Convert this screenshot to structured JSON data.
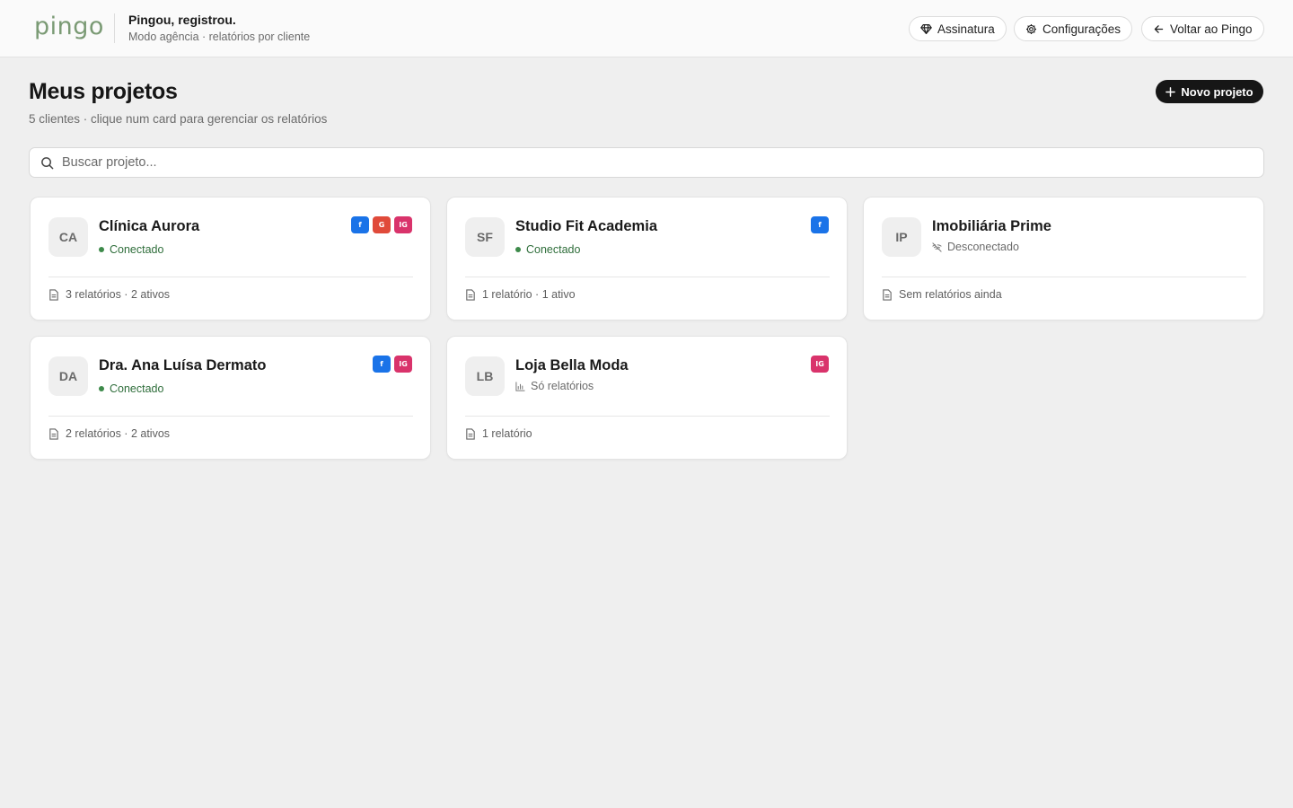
{
  "header": {
    "logo": "pingo",
    "title": "Pingou, registrou.",
    "subtitle": "Modo agência · relatórios por cliente",
    "buttons": {
      "subscription": "Assinatura",
      "settings": "Configurações",
      "back": "Voltar ao Pingo"
    }
  },
  "page": {
    "title": "Meus projetos",
    "subtitle": "5 clientes · clique num card para gerenciar os relatórios",
    "new_button": "Novo projeto"
  },
  "search": {
    "placeholder": "Buscar projeto..."
  },
  "projects": [
    {
      "initials": "CA",
      "name": "Clínica Aurora",
      "status": "Conectado",
      "status_type": "connected",
      "badges": [
        "f",
        "G",
        "IG"
      ],
      "footer": "3 relatórios · 2 ativos"
    },
    {
      "initials": "SF",
      "name": "Studio Fit Academia",
      "status": "Conectado",
      "status_type": "connected",
      "badges": [
        "f"
      ],
      "footer": "1 relatório · 1 ativo"
    },
    {
      "initials": "IP",
      "name": "Imobiliária Prime",
      "status": "Desconectado",
      "status_type": "disconnected",
      "badges": [],
      "footer": "Sem relatórios ainda"
    },
    {
      "initials": "DA",
      "name": "Dra. Ana Luísa Dermato",
      "status": "Conectado",
      "status_type": "connected",
      "badges": [
        "f",
        "IG"
      ],
      "footer": "2 relatórios · 2 ativos"
    },
    {
      "initials": "LB",
      "name": "Loja Bella Moda",
      "status": "Só relatórios",
      "status_type": "reports",
      "badges": [
        "IG"
      ],
      "footer": "1 relatório"
    }
  ],
  "colors": {
    "logo": "#7a9a74",
    "connected": "#2f6e3b",
    "facebook": "#1a73e8",
    "google": "#e04a3a",
    "instagram": "#d9336b",
    "primary_button": "#161616"
  },
  "icons": {
    "subscription": "diamond-icon",
    "settings": "gear-icon",
    "back": "arrow-left-icon",
    "new": "plus-icon",
    "search": "search-icon",
    "report": "document-icon",
    "disconnected": "wifi-off-icon",
    "reports_only": "bar-chart-icon"
  }
}
